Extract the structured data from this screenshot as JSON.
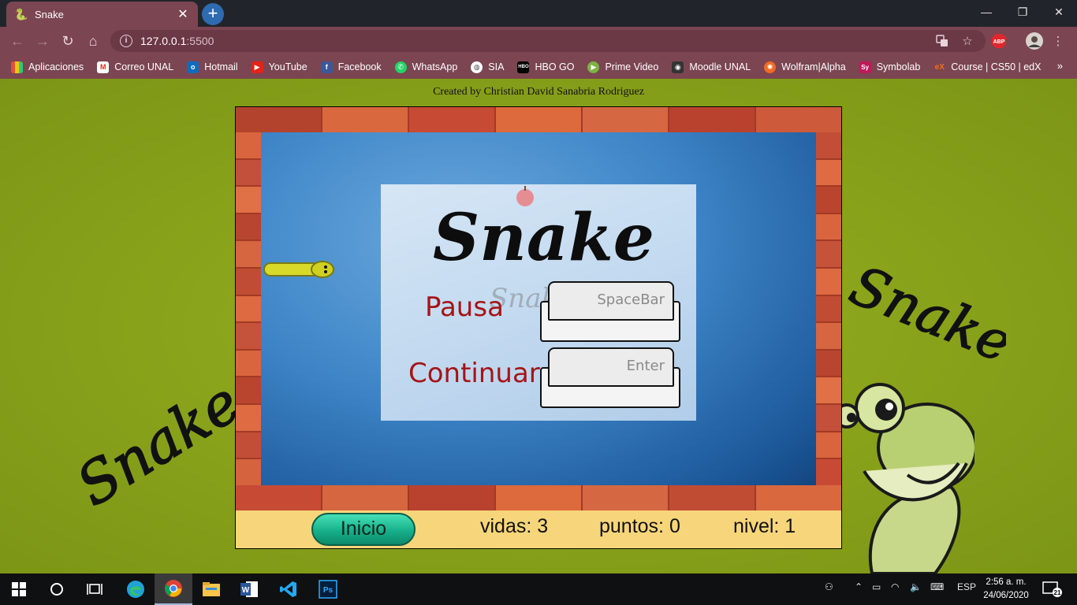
{
  "browser": {
    "tab": {
      "title": "Snake",
      "close": "✕"
    },
    "new_tab": "+",
    "window_controls": {
      "minimize": "—",
      "restore": "❐",
      "close": "✕"
    },
    "url": {
      "host": "127.0.0.1",
      "port": ":5500"
    },
    "bookmarks": [
      {
        "label": "Aplicaciones",
        "icon": "apps-grid-icon",
        "color": "#e74c3c"
      },
      {
        "label": "Correo UNAL",
        "icon": "gmail-icon",
        "color": "#ffffff"
      },
      {
        "label": "Hotmail",
        "icon": "outlook-icon",
        "color": "#0f6cbd"
      },
      {
        "label": "YouTube",
        "icon": "youtube-icon",
        "color": "#e62117"
      },
      {
        "label": "Facebook",
        "icon": "facebook-icon",
        "color": "#3b5998"
      },
      {
        "label": "WhatsApp",
        "icon": "whatsapp-icon",
        "color": "#25d366"
      },
      {
        "label": "SIA",
        "icon": "globe-icon",
        "color": "#ffffff"
      },
      {
        "label": "HBO GO",
        "icon": "hbo-icon",
        "color": "#000000"
      },
      {
        "label": "Prime Video",
        "icon": "play-icon",
        "color": "#7cb342"
      },
      {
        "label": "Moodle UNAL",
        "icon": "moodle-icon",
        "color": "#333333"
      },
      {
        "label": "Wolfram|Alpha",
        "icon": "wolfram-icon",
        "color": "#f26b21"
      },
      {
        "label": "Symbolab",
        "icon": "symbolab-icon",
        "color": "#c2185b"
      },
      {
        "label": "Course | CS50 | edX",
        "icon": "edx-icon",
        "color": "#02262b"
      }
    ],
    "bookmarks_more": "»",
    "abp_label": "ABP"
  },
  "page": {
    "credit": "Created by Christian David Sanabria Rodriguez",
    "panel": {
      "logo": "Snake",
      "pause_label": "Pausa",
      "continue_label": "Continuar",
      "pause_key": "SpaceBar",
      "continue_key": "Enter"
    },
    "status": {
      "start_button": "Inicio",
      "lives": "vidas: 3",
      "points": "puntos: 0",
      "level": "nivel: 1"
    },
    "side_logo": "Snake"
  },
  "taskbar": {
    "language": "ESP",
    "time": "2:56 a. m.",
    "date": "24/06/2020",
    "notifications": "21"
  }
}
